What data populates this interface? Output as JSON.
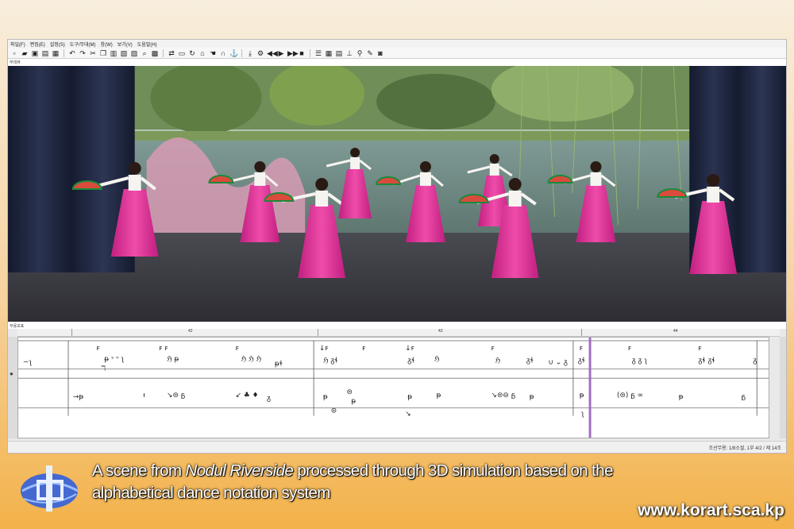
{
  "window": {
    "menu": [
      "파일(F)",
      "편집(E)",
      "설정(S)",
      "도구/무대(M)",
      "창(W)",
      "보기(V)",
      "도움말(H)"
    ],
    "stage_panel_title": "무대뷰",
    "notation_panel_title": "무용보표"
  },
  "toolbar_icons": [
    "new-icon",
    "open-icon",
    "save-icon",
    "save-as-icon",
    "print-icon",
    "undo-icon",
    "redo-icon",
    "cut-icon",
    "copy-icon",
    "paste-icon",
    "delete-icon",
    "select-all-icon",
    "zoom-icon",
    "fit-icon",
    "transform-icon",
    "symbol-icon",
    "rotate-icon",
    "stage-icon",
    "hand-icon",
    "loop-icon",
    "anchor-icon",
    "import-icon",
    "settings-icon",
    "rewind-icon",
    "play-icon",
    "fast-forward-icon",
    "stop-icon",
    "list-icon",
    "grid-icon",
    "layer-icon",
    "track-icon",
    "dancer-icon",
    "edit-icon",
    "camera-icon"
  ],
  "ruler": {
    "marks": [
      "42",
      "43",
      "44"
    ]
  },
  "status": {
    "text": "조선무용: 1/8소절, 1부 4/2 / 제 14조"
  },
  "caption": {
    "pre": "A scene from ",
    "title": "Nodul Riverside",
    "post": " processed through 3D simulation based on the alphabetical dance notation system"
  },
  "url": "www.korart.sca.kp",
  "colors": {
    "accent": "#f3b24a",
    "dress": "#e0369b",
    "playhead": "#a26cc4"
  }
}
